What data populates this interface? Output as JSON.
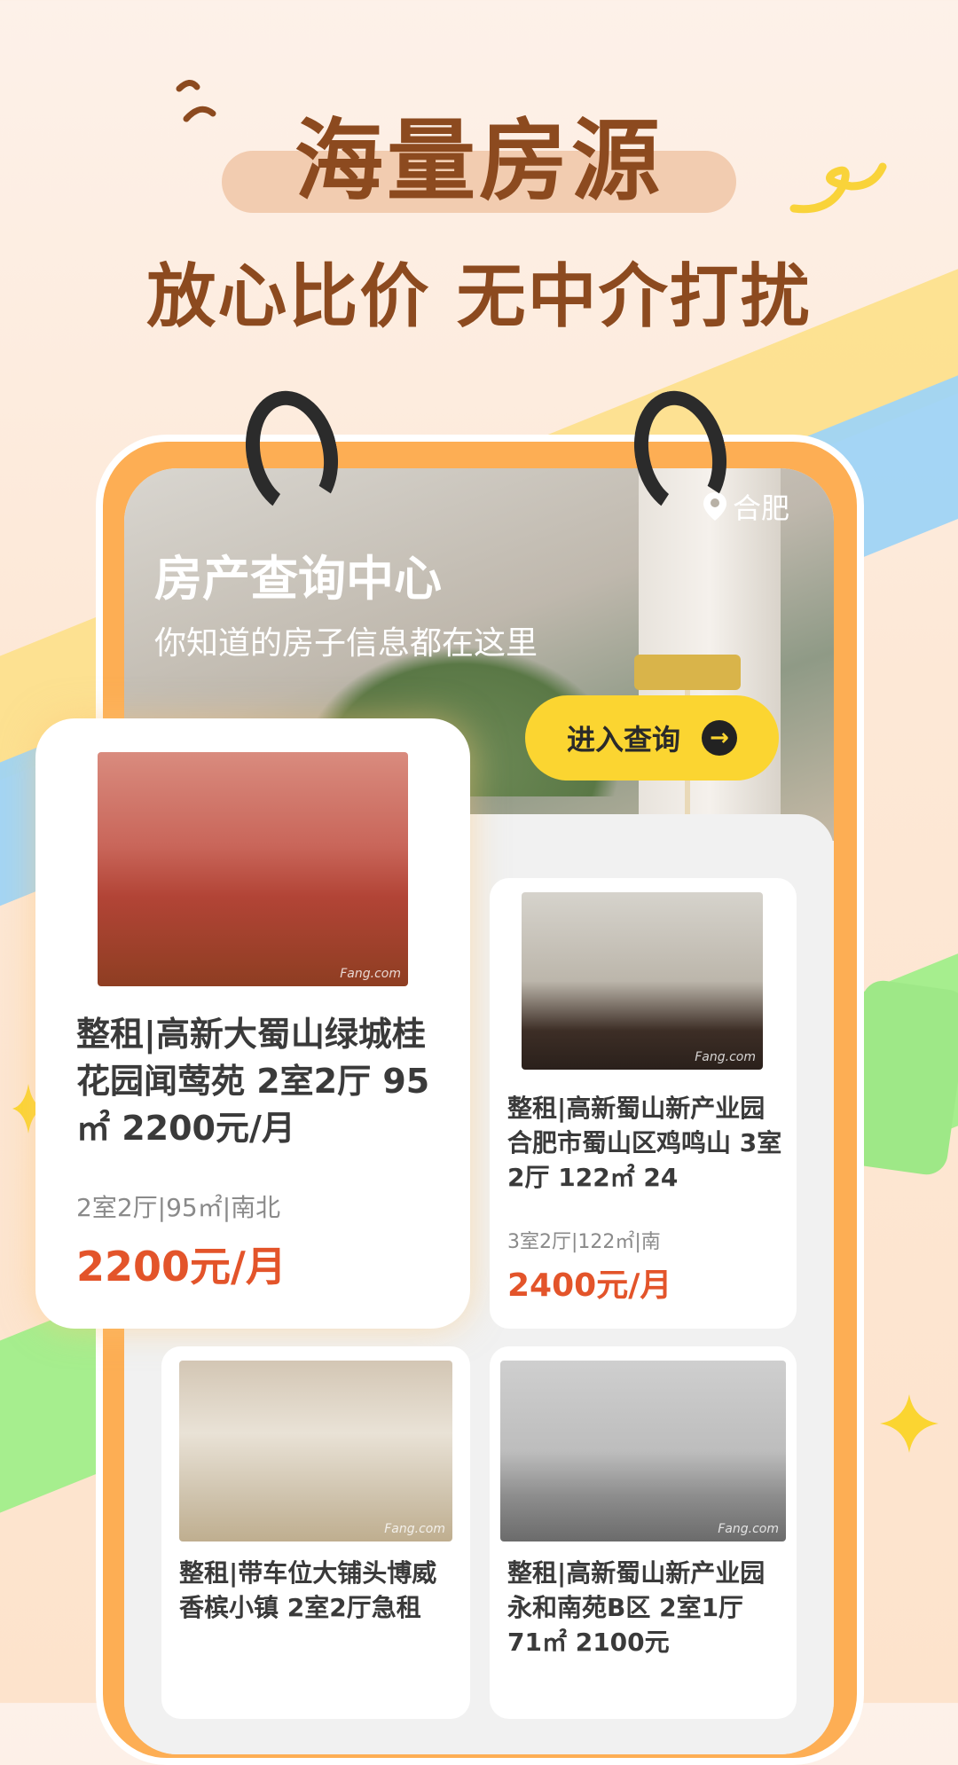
{
  "promo": {
    "headline": "海量房源",
    "subheadline": "放心比价 无中介打扰"
  },
  "hero": {
    "city": "合肥",
    "title": "房产查询中心",
    "subtitle": "你知道的房子信息都在这里",
    "query_button": "进入查询"
  },
  "listings": [
    {
      "title": "整租|高新大蜀山绿城桂花园闻莺苑 2室2厅 95㎡ 2200元/月",
      "meta": "2室2厅|95㎡|南北",
      "price": "2200元/月",
      "watermark": "Fang.com"
    },
    {
      "title": "整租|高新蜀山新产业园合肥市蜀山区鸡鸣山 3室2厅 122㎡ 24",
      "meta": "3室2厅|122㎡|南",
      "price": "2400元/月",
      "watermark": "Fang.com"
    },
    {
      "title": "整租|带车位大铺头博威香槟小镇 2室2厅急租",
      "watermark": "Fang.com"
    },
    {
      "title": "整租|高新蜀山新产业园永和南苑B区 2室1厅 71㎡ 2100元",
      "watermark": "Fang.com"
    }
  ],
  "colors": {
    "accent_orange": "#fdae54",
    "price_red": "#e3542a",
    "button_yellow": "#fbd531",
    "headline_brown": "#8c4a1f"
  }
}
